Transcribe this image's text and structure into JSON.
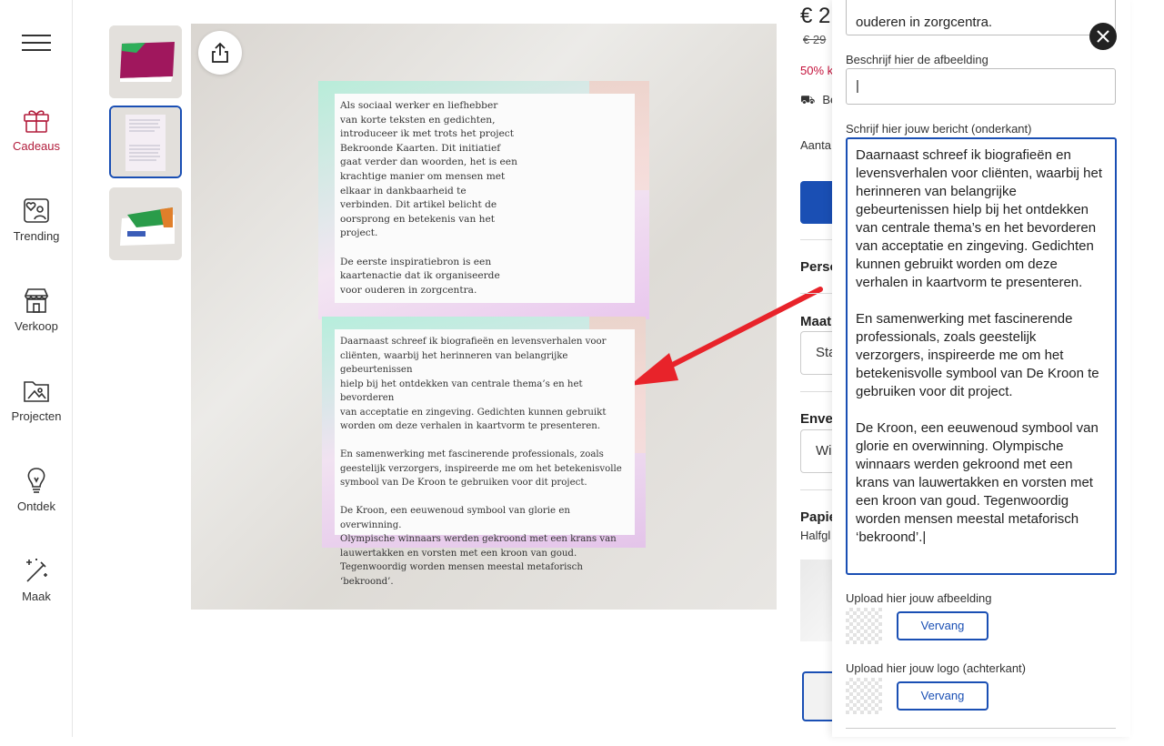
{
  "nav": {
    "items": [
      {
        "label": "Cadeaus"
      },
      {
        "label": "Trending"
      },
      {
        "label": "Verkoop"
      },
      {
        "label": "Projecten"
      },
      {
        "label": "Ontdek"
      },
      {
        "label": "Maak"
      }
    ]
  },
  "card": {
    "top_text": "Als sociaal werker en liefhebber\nvan korte teksten en gedichten,\nintroduceer ik met trots het project\nBekroonde Kaarten. Dit initiatief\ngaat verder dan woorden, het is een\nkrachtige manier om mensen met\nelkaar in dankbaarheid te\nverbinden. Dit artikel belicht de\noorsprong en betekenis van het\nproject.\n\nDe eerste inspiratiebron is een\nkaartenactie dat ik organiseerde\nvoor ouderen in zorgcentra.",
    "bottom_text": "Daarnaast schreef ik biografieën en levensverhalen voor\ncliënten, waarbij het herinneren van belangrijke gebeurtenissen\nhielp bij het ontdekken van centrale thema’s en het bevorderen\nvan acceptatie en zingeving. Gedichten kunnen gebruikt\nworden om deze verhalen in kaartvorm te presenteren.\n\nEn samenwerking met fascinerende professionals, zoals\ngeestelijk verzorgers, inspireerde me om het betekenisvolle\nsymbool van De Kroon te gebruiken voor dit project.\n\nDe Kroon, een eeuwenoud symbool van glorie en overwinning.\nOlympische winnaars werden gekroond met een krans van\nlauwertakken en vorsten met een kroon van goud.\nTegenwoordig worden mensen meestal metaforisch ‘bekroond’."
  },
  "product": {
    "price": "€ 2",
    "old_price": "€ 29",
    "discount": "50% k",
    "delivery": "Be",
    "quantity_label": "Aanta",
    "sections": {
      "personalize": "Perso",
      "size": "Maat",
      "size_value": "Sta",
      "envelope": "Enve",
      "envelope_value": "Wi",
      "paper": "Papie",
      "paper_value": "Halfgl"
    }
  },
  "panel": {
    "top_field_value": "ouderen in zorgcentra.",
    "image_desc_label": "Beschrijf hier de afbeelding",
    "image_desc_value": "|",
    "message_label": "Schrijf hier jouw bericht (onderkant)",
    "message_value": "Daarnaast schreef ik biografieën en levensverhalen voor cliënten, waarbij het herinneren van belangrijke gebeurtenissen hielp bij het ontdekken van centrale thema’s en het bevorderen van acceptatie en zingeving. Gedichten kunnen gebruikt worden om deze verhalen in kaartvorm te presenteren.\n\nEn samenwerking met fascinerende professionals, zoals geestelijk verzorgers, inspireerde me om het betekenisvolle symbool van De Kroon te gebruiken voor dit project.\n\nDe Kroon, een eeuwenoud symbool van glorie en overwinning. Olympische winnaars werden gekroond met een krans van lauwertakken en vorsten met een kroon van goud. Tegenwoordig worden mensen meestal metaforisch ‘bekroond’.|",
    "upload_image_label": "Upload hier jouw afbeelding",
    "upload_logo_label": "Upload hier jouw logo (achterkant)",
    "replace_label": "Vervang"
  },
  "colors": {
    "accent": "#1a4fb4",
    "active_nav": "#b21d3c",
    "discount": "#c4123b",
    "arrow": "#e8232a"
  }
}
